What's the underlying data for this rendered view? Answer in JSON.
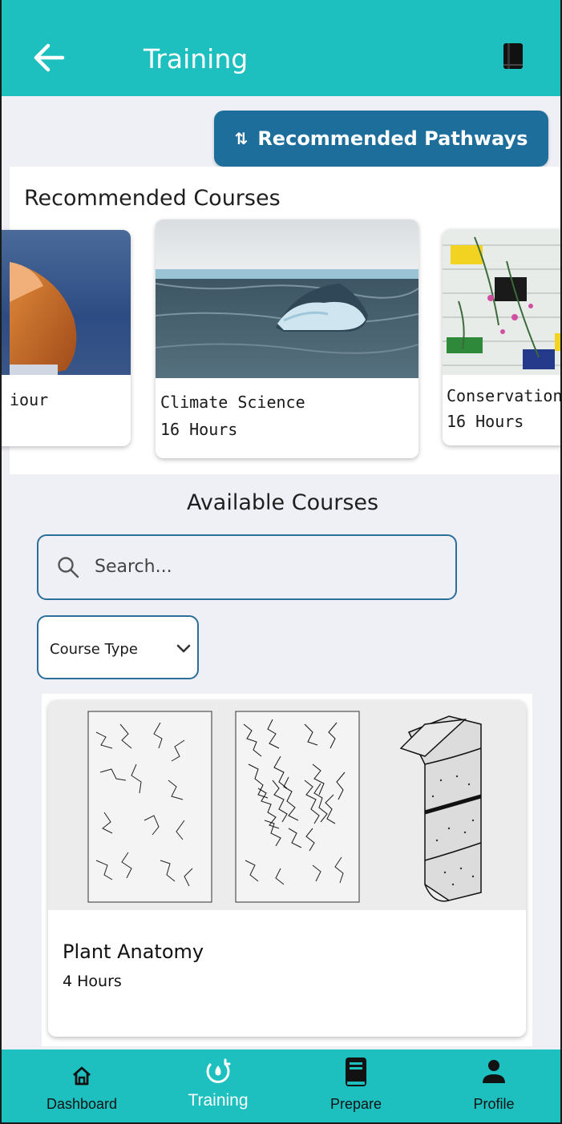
{
  "header": {
    "title": "Training",
    "back_icon": "arrow-left-icon",
    "right_icon": "book-icon"
  },
  "pathways": {
    "label": "Recommended Pathways",
    "icon": "route-icon"
  },
  "recommended": {
    "title": "Recommended Courses",
    "courses": [
      {
        "title": "iour",
        "hours": "",
        "image": "fox"
      },
      {
        "title": "Climate Science",
        "hours": "16 Hours",
        "image": "iceberg"
      },
      {
        "title": "Conservation",
        "hours": "16 Hours",
        "image": "garden-wall"
      }
    ]
  },
  "available": {
    "title": "Available Courses",
    "search_placeholder": "Search...",
    "course_type_label": "Course Type",
    "courses": [
      {
        "title": "Plant Anatomy",
        "hours": "4 Hours",
        "image": "plant-tissue-drawing"
      }
    ]
  },
  "nav": {
    "active": "Training",
    "items": [
      {
        "label": "Dashboard",
        "icon": "home-icon"
      },
      {
        "label": "Training",
        "icon": "training-icon"
      },
      {
        "label": "Prepare",
        "icon": "book-icon"
      },
      {
        "label": "Profile",
        "icon": "person-icon"
      }
    ]
  },
  "colors": {
    "header": "#1dbfbf",
    "pathways_button": "#1e6e9c",
    "input_border": "#2a6e99",
    "background": "#eff0f6"
  }
}
